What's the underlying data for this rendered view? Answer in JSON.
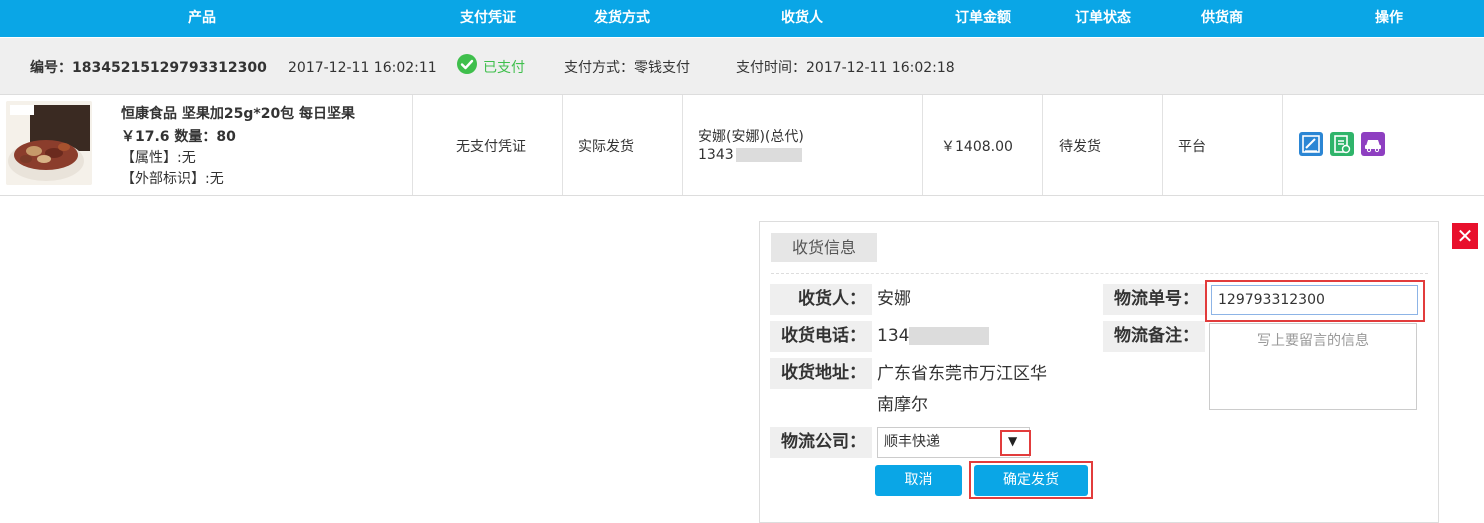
{
  "header": {
    "columns": [
      "产品",
      "支付凭证",
      "发货方式",
      "收货人",
      "订单金额",
      "订单状态",
      "供货商",
      "操作"
    ]
  },
  "order": {
    "number_label": "编号：18345215129793312300",
    "created_time": "2017-12-11 16:02:11",
    "pay_status": "已支付",
    "pay_method": "支付方式：零钱支付",
    "pay_time": "支付时间：2017-12-11 16:02:18"
  },
  "item": {
    "name": "恒康食品 坚果加25g*20包 每日坚果",
    "price_qty": "￥17.6 数量：80",
    "attr": "【属性】:无",
    "external_id": "【外部标识】:无",
    "voucher": "无支付凭证",
    "ship_method": "实际发货",
    "receiver_name": "安娜(安娜)(总代)",
    "receiver_phone": "1343",
    "amount": "￥1408.00",
    "status": "待发货",
    "supplier": "平台"
  },
  "colors": {
    "header_bg": "#0aa6e6",
    "paid_green": "#3fbf4c",
    "highlight_red": "#e23c3c",
    "close_red": "#e8102c"
  },
  "icons": {
    "op1": "edit-order-icon",
    "op2": "invoice-icon",
    "op3": "car-ship-icon"
  },
  "panel": {
    "title": "收货信息",
    "receiver_label": "收货人：",
    "receiver_value": "安娜",
    "phone_label": "收货电话：",
    "phone_value": "134",
    "address_label": "收货地址：",
    "address_line1": "广东省东莞市万江区华",
    "address_line2": "南摩尔",
    "company_label": "物流公司：",
    "company_value": "顺丰快递",
    "tracking_label": "物流单号：",
    "tracking_value": "129793312300",
    "note_label": "物流备注：",
    "note_placeholder": "写上要留言的信息",
    "cancel_label": "取消",
    "confirm_label": "确定发货"
  }
}
